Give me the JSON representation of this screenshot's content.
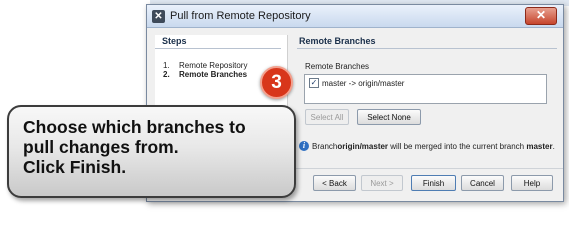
{
  "dialog": {
    "title": "Pull from Remote Repository",
    "close_label": "✕"
  },
  "steps": {
    "heading": "Steps",
    "items": [
      {
        "num": "1.",
        "label": "Remote Repository"
      },
      {
        "num": "2.",
        "label": "Remote Branches"
      }
    ]
  },
  "remote_branches": {
    "heading": "Remote Branches",
    "list_label": "Remote Branches",
    "branches": [
      {
        "label": "master -> origin/master",
        "checked": true
      }
    ],
    "select_all_label": "Select All",
    "select_none_label": "Select None",
    "info_prefix": "Branch ",
    "info_branch": "origin/master",
    "info_middle": " will be merged into the current branch ",
    "info_current": "master",
    "info_suffix": "."
  },
  "buttons": {
    "back": "< Back",
    "next": "Next >",
    "finish": "Finish",
    "cancel": "Cancel",
    "help": "Help"
  },
  "annotation": {
    "step_number": "3",
    "lines": [
      "Choose which branches to",
      "pull changes from.",
      "Click Finish."
    ]
  }
}
